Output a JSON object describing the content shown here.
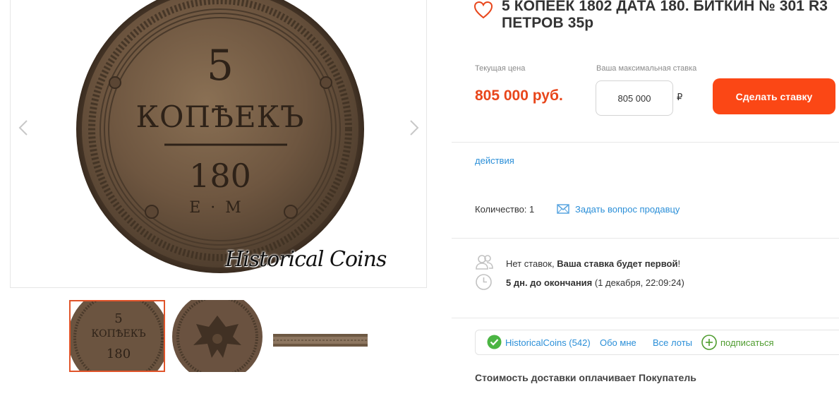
{
  "gallery": {
    "watermark": "Historical Coins",
    "coin": {
      "denomination": "5",
      "word": "КОПѢЕКЪ",
      "year": "180",
      "mint": "Е·М"
    },
    "thumbnails": [
      {
        "name": "obverse"
      },
      {
        "name": "reverse-eagle"
      },
      {
        "name": "edge"
      }
    ]
  },
  "lot": {
    "title": "5 КОПЕЕК 1802 ДАТА 180. БИТКИН № 301 R3 ПЕТРОВ 35р",
    "price_label": "Текущая цена",
    "current_price": "805 000 руб.",
    "bid_label": "Ваша максимальная ставка",
    "bid_value": "805 000",
    "currency_sign": "₽",
    "bid_button": "Сделать ставку",
    "actions_link": "действия",
    "quantity": "Количество: 1",
    "ask_seller": "Задать вопрос продавцу",
    "bids_prefix": "Нет ставок, ",
    "bids_bold": "Ваша ставка будет первой",
    "bids_suffix": "!",
    "time_bold": "5 дн. до окончания",
    "time_rest": " (1 декабря, 22:09:24)",
    "seller": {
      "name": "HistoricalCoins (542)",
      "about": "Обо мне",
      "all_lots": "Все лоты",
      "subscribe": "подписаться"
    },
    "shipping": "Стоимость доставки оплачивает Покупатель"
  },
  "colors": {
    "accent": "#fb4715",
    "price": "#e8461b",
    "link": "#2b8fd8",
    "subscribe": "#4f9c2f",
    "thumb_selected_border": "#e0542a"
  }
}
